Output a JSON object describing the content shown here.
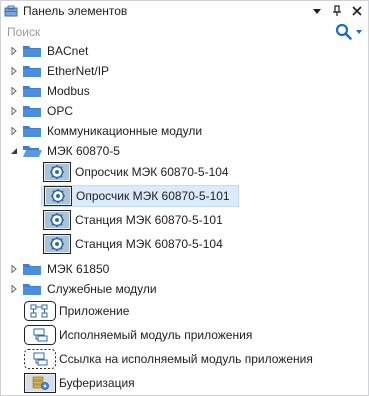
{
  "titlebar": {
    "title": "Панель элементов",
    "app_icon": "toolbox-icon",
    "buttons": [
      "dropdown-arrow-icon",
      "pin-icon",
      "close-icon"
    ]
  },
  "search": {
    "placeholder": "Поиск",
    "icon": "search-icon"
  },
  "tree": {
    "groups": [
      {
        "label": "BACnet",
        "expanded": false
      },
      {
        "label": "EtherNet/IP",
        "expanded": false
      },
      {
        "label": "Modbus",
        "expanded": false
      },
      {
        "label": "OPC",
        "expanded": false
      },
      {
        "label": "Коммуникационные модули",
        "expanded": false
      },
      {
        "label": "МЭК 60870-5",
        "expanded": true
      },
      {
        "label": "МЭК 61850",
        "expanded": false
      },
      {
        "label": "Служебные модули",
        "expanded": false
      }
    ],
    "iec_children": [
      {
        "label": "Опросчик МЭК 60870-5-104",
        "selected": false
      },
      {
        "label": "Опросчик МЭК 60870-5-101",
        "selected": true
      },
      {
        "label": "Станция МЭК 60870-5-101",
        "selected": false
      },
      {
        "label": "Станция МЭК 60870-5-104",
        "selected": false
      }
    ],
    "items": [
      {
        "label": "Приложение",
        "icon": "application-icon"
      },
      {
        "label": "Исполняемый модуль приложения",
        "icon": "executable-module-icon"
      },
      {
        "label": "Ссылка на исполняемый модуль приложения",
        "icon": "executable-module-link-icon"
      },
      {
        "label": "Буферизация",
        "icon": "buffering-icon"
      }
    ]
  },
  "colors": {
    "folder": "#3a7fd0",
    "selection": "#dcebfc",
    "accent": "#1e6bc7"
  }
}
